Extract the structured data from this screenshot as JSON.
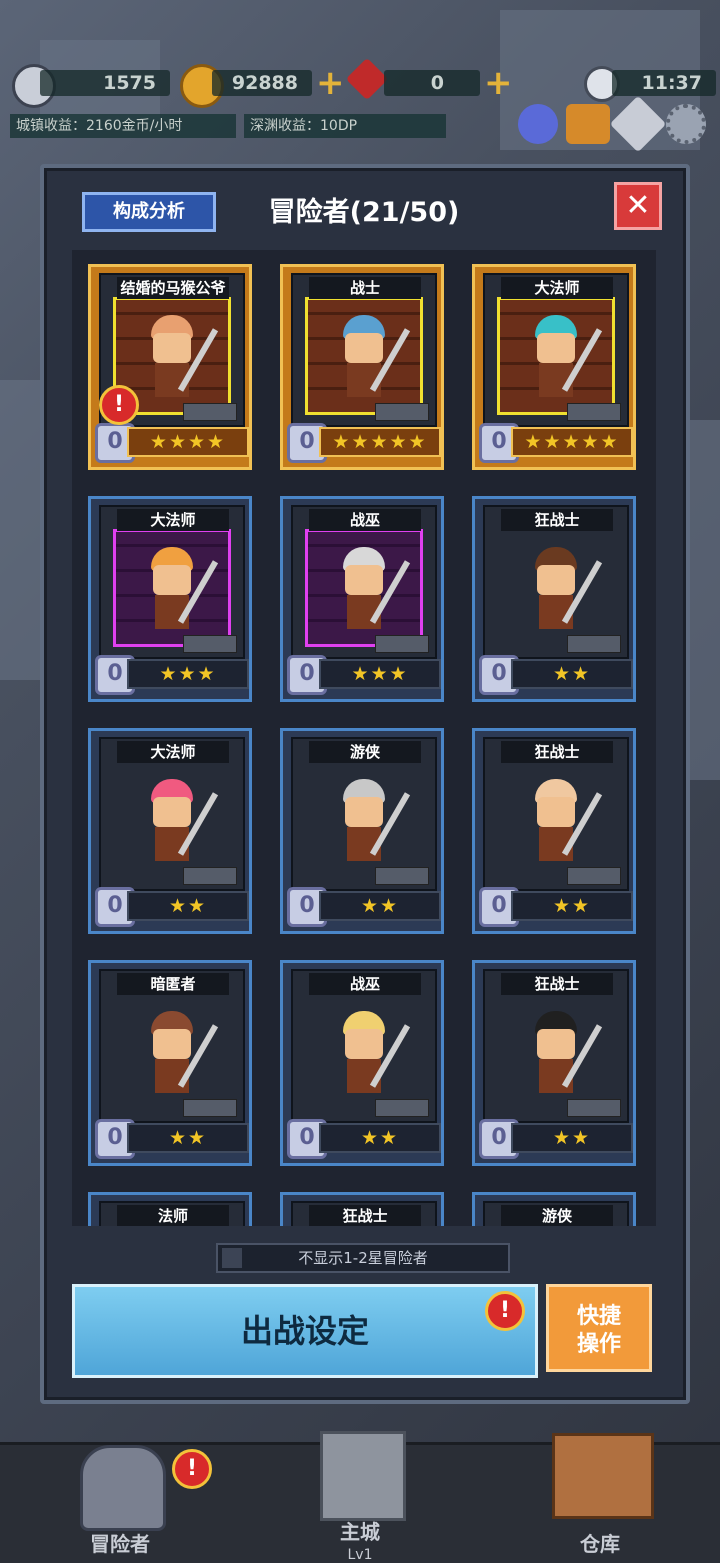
{
  "hud": {
    "soul": "1575",
    "gold": "92888",
    "gem": "0",
    "time": "11:37",
    "town_income": "城镇收益：2160金币/小时",
    "abyss_income": "深渊收益：10DP"
  },
  "panel": {
    "analysis_label": "构成分析",
    "title": "冒险者(21/50)",
    "close_label": "✕",
    "toggle_label": "不显示1-2星冒险者",
    "deploy_label": "出战设定",
    "quick_label_1": "快捷",
    "quick_label_2": "操作"
  },
  "cards": [
    {
      "name": "结婚的马猴公爷",
      "stars": "★★★★",
      "rarity": "gold",
      "hair": "#e8a070",
      "alert": true
    },
    {
      "name": "战士",
      "stars": "★★★★★",
      "rarity": "gold",
      "hair": "#5aa0d0"
    },
    {
      "name": "大法师",
      "stars": "★★★★★",
      "rarity": "gold",
      "hair": "#38c0c8"
    },
    {
      "name": "大法师",
      "stars": "★★★",
      "rarity": "purple",
      "hair": "#f0a040"
    },
    {
      "name": "战巫",
      "stars": "★★★",
      "rarity": "purple",
      "hair": "#d8d8d8"
    },
    {
      "name": "狂战士",
      "stars": "★★",
      "rarity": "blue",
      "hair": "#6a3a20"
    },
    {
      "name": "大法师",
      "stars": "★★",
      "rarity": "blue",
      "hair": "#f05a80"
    },
    {
      "name": "游侠",
      "stars": "★★",
      "rarity": "blue",
      "hair": "#c8c8c8"
    },
    {
      "name": "狂战士",
      "stars": "★★",
      "rarity": "blue",
      "hair": "#f0c8a0"
    },
    {
      "name": "暗匿者",
      "stars": "★★",
      "rarity": "blue",
      "hair": "#8a4a30"
    },
    {
      "name": "战巫",
      "stars": "★★",
      "rarity": "blue",
      "hair": "#f0d070"
    },
    {
      "name": "狂战士",
      "stars": "★★",
      "rarity": "blue",
      "hair": "#202020"
    },
    {
      "name": "法师",
      "stars": "",
      "rarity": "blue",
      "hair": "#888"
    },
    {
      "name": "狂战士",
      "stars": "",
      "rarity": "blue",
      "hair": "#888"
    },
    {
      "name": "游侠",
      "stars": "",
      "rarity": "blue",
      "hair": "#888"
    }
  ],
  "nav": {
    "adventurers": "冒险者",
    "castle": "主城",
    "castle_level": "Lv1",
    "warehouse": "仓库"
  }
}
